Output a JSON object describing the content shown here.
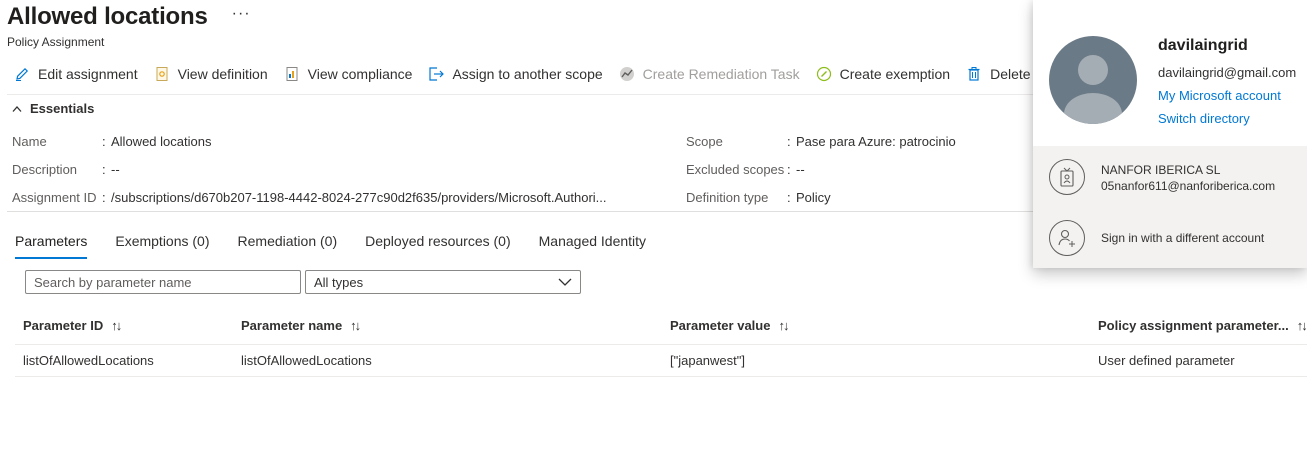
{
  "header": {
    "title": "Allowed locations",
    "more": "···",
    "subtitle": "Policy Assignment"
  },
  "toolbar": {
    "edit_assignment": "Edit assignment",
    "view_definition": "View definition",
    "view_compliance": "View compliance",
    "assign_scope": "Assign to another scope",
    "create_remediation": "Create Remediation Task",
    "create_exemption": "Create exemption",
    "delete_assignment": "Delete assignmen"
  },
  "essentials": {
    "header": "Essentials",
    "name_label": "Name",
    "name_value": "Allowed locations",
    "description_label": "Description",
    "description_value": "--",
    "assignment_id_label": "Assignment ID",
    "assignment_id_value": "/subscriptions/d670b207-1198-4442-8024-277c90d2f635/providers/Microsoft.Authori...",
    "scope_label": "Scope",
    "scope_value": "Pase para Azure: patrocinio",
    "excluded_label": "Excluded scopes",
    "excluded_value": "--",
    "deftype_label": "Definition type",
    "deftype_value": "Policy",
    "colon": ":"
  },
  "tabs": {
    "parameters": "Parameters",
    "exemptions": "Exemptions (0)",
    "remediation": "Remediation (0)",
    "deployed": "Deployed resources (0)",
    "identity": "Managed Identity"
  },
  "filters": {
    "search_placeholder": "Search by parameter name",
    "type_selected": "All types"
  },
  "table": {
    "headers": {
      "param_id": "Parameter ID",
      "param_name": "Parameter name",
      "param_value": "Parameter value",
      "assignment_param": "Policy assignment parameter..."
    },
    "sort_glyph": "↑↓",
    "rows": [
      {
        "param_id": "listOfAllowedLocations",
        "param_name": "listOfAllowedLocations",
        "param_value": "[\"japanwest\"]",
        "assignment_param": "User defined parameter"
      }
    ]
  },
  "account": {
    "username": "davilaingrid",
    "email": "davilaingrid@gmail.com",
    "my_account": "My Microsoft account",
    "switch_directory": "Switch directory",
    "org_name": "NANFOR IBERICA SL",
    "org_email": "05nanfor611@nanforiberica.com",
    "sign_in_other": "Sign in with a different account"
  },
  "colors": {
    "accent": "#0078d4",
    "avatar_bg": "#6b7a87",
    "flyout_lower_bg": "#f3f2f1"
  }
}
